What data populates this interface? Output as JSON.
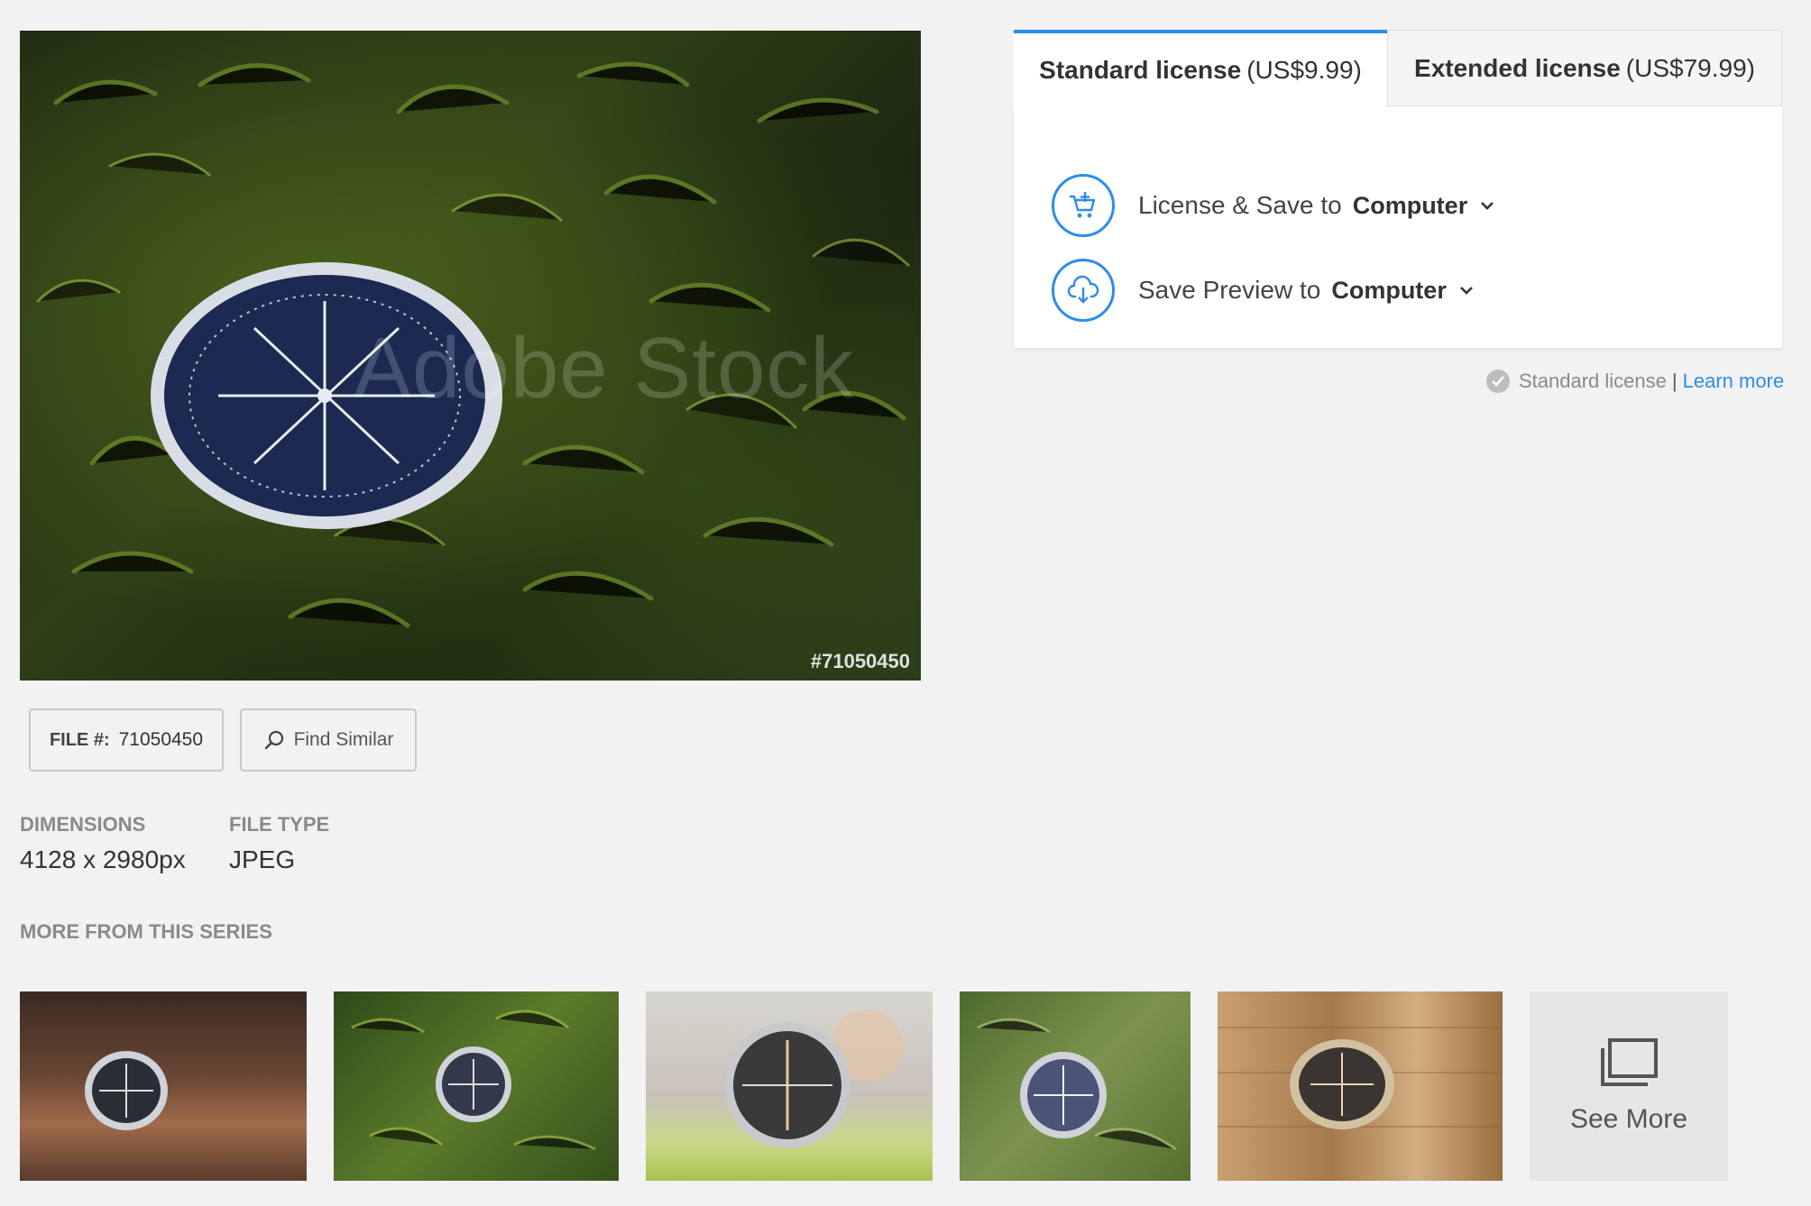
{
  "preview": {
    "watermark": "Adobe Stock",
    "file_tag": "#71050450"
  },
  "file_button": {
    "label": "FILE #:",
    "value": "71050450"
  },
  "find_similar": {
    "label": "Find Similar"
  },
  "meta": {
    "dimensions_label": "DIMENSIONS",
    "dimensions_value": "4128 x 2980px",
    "file_type_label": "FILE TYPE",
    "file_type_value": "JPEG"
  },
  "series": {
    "title": "MORE FROM THIS SERIES",
    "see_more": "See More"
  },
  "license": {
    "tabs": [
      {
        "name": "Standard license",
        "price": "(US$9.99)"
      },
      {
        "name": "Extended license",
        "price": "(US$79.99)"
      }
    ],
    "actions": [
      {
        "label": "License & Save to",
        "target": "Computer",
        "icon": "cart-add-icon"
      },
      {
        "label": "Save Preview to",
        "target": "Computer",
        "icon": "cloud-download-icon"
      }
    ],
    "note": {
      "text": "Standard license",
      "separator": "|",
      "link": "Learn more"
    }
  },
  "colors": {
    "accent": "#2d8ceb",
    "background": "#f2f2f2",
    "muted_text": "#8a8a8a"
  }
}
